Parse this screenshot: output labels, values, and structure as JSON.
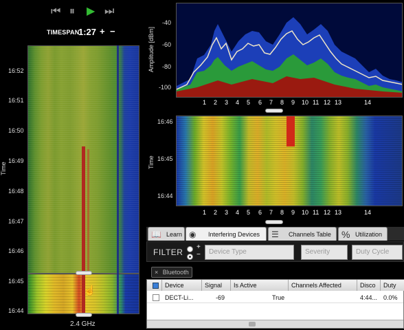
{
  "transport": {
    "skip_back_icon": "skip-back-icon",
    "pause_icon": "pause-icon",
    "play_icon": "play-icon",
    "fast_forward_icon": "fast-forward-icon"
  },
  "timespan": {
    "label": "TIMESPAN",
    "value": "1:27",
    "plus": "+",
    "minus": "−"
  },
  "left_waterfall": {
    "axis_title": "Time",
    "times": [
      "16:52",
      "16:51",
      "16:50",
      "16:49",
      "16:48",
      "16:47",
      "16:46",
      "16:45",
      "16:44"
    ],
    "band_label": "2.4 GHz"
  },
  "spectrum": {
    "axis_title": "Amplitude [dBm]",
    "y_ticks": [
      "-40",
      "-60",
      "-80",
      "-100"
    ],
    "channels": [
      "1",
      "2",
      "3",
      "4",
      "5",
      "6",
      "7",
      "8",
      "9",
      "10",
      "11",
      "12",
      "13",
      "14"
    ]
  },
  "waterfall": {
    "axis_title": "Time",
    "times": [
      "16:46",
      "16:45",
      "16:44"
    ],
    "channels": [
      "1",
      "2",
      "3",
      "4",
      "5",
      "6",
      "7",
      "8",
      "9",
      "10",
      "11",
      "12",
      "13",
      "14"
    ]
  },
  "tabs": [
    {
      "label": "Learn",
      "icon": "book-icon",
      "active": false
    },
    {
      "label": "Interfering Devices",
      "icon": "signal-icon",
      "active": true
    },
    {
      "label": "Channels Table",
      "icon": "list-icon",
      "active": false
    },
    {
      "label": "Utilization",
      "icon": "percent-icon",
      "active": false
    }
  ],
  "filter": {
    "title": "FILTER",
    "add": "+",
    "remove": "−",
    "device_type_placeholder": "Device Type",
    "severity_placeholder": "Severity",
    "duty_cycle_placeholder": "Duty Cycle",
    "chip": "Bluetooth",
    "chip_close": "×"
  },
  "table": {
    "columns": [
      "Device",
      "Signal",
      "Is Active",
      "Channels Affected",
      "Disco",
      "Duty"
    ],
    "rows": [
      {
        "device": "DECT-Li...",
        "signal": "-69",
        "active": "True",
        "channels": "",
        "disco": "4:44...",
        "duty": "0.0%"
      }
    ]
  }
}
